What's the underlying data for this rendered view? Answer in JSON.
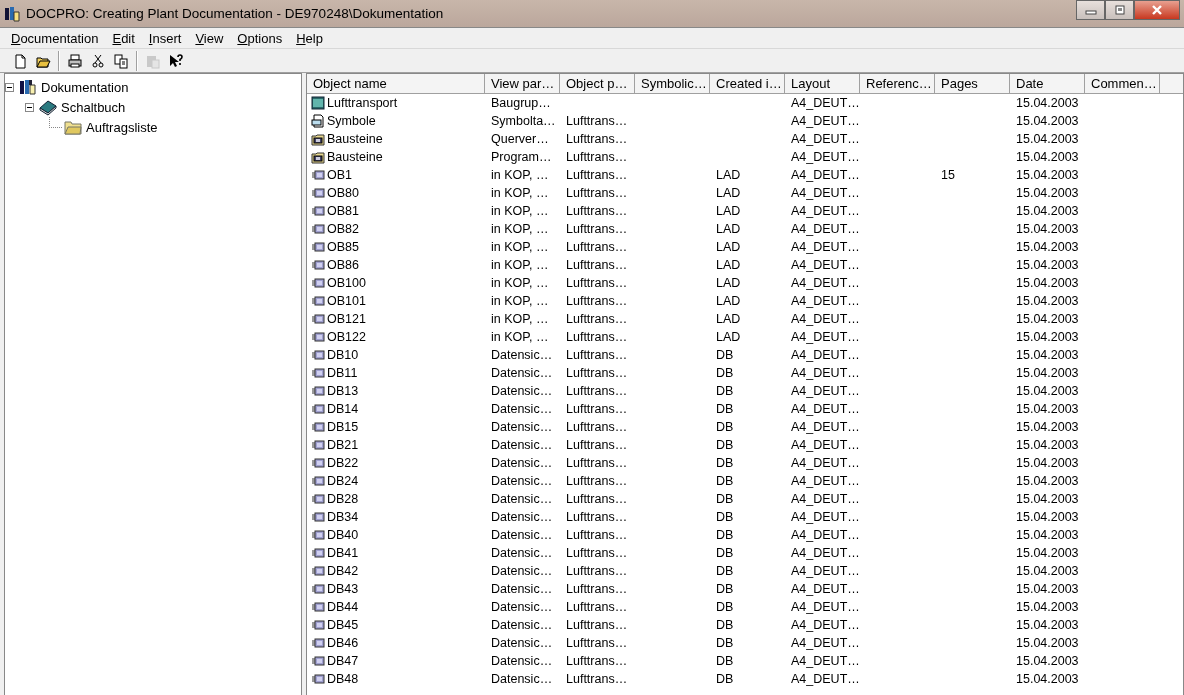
{
  "window": {
    "title": "DOCPRO: Creating Plant Documentation - DE970248\\Dokumentation"
  },
  "menu": [
    "Documentation",
    "Edit",
    "Insert",
    "View",
    "Options",
    "Help"
  ],
  "toolbar": [
    [
      {
        "kind": "new",
        "disabled": false
      },
      {
        "kind": "open",
        "disabled": false
      }
    ],
    [
      {
        "kind": "print",
        "disabled": false
      },
      {
        "kind": "cut",
        "disabled": false
      },
      {
        "kind": "copy",
        "disabled": false
      }
    ],
    [
      {
        "kind": "paste",
        "disabled": true
      },
      {
        "kind": "help",
        "disabled": false
      }
    ]
  ],
  "tree": [
    {
      "label": "Dokumentation",
      "kind": "docs",
      "expanded": true,
      "children": [
        {
          "label": "Schaltbuch",
          "kind": "book",
          "expanded": true,
          "children": [
            {
              "label": "Auftragsliste",
              "kind": "folder"
            }
          ]
        }
      ]
    }
  ],
  "table": {
    "columns": [
      "Object name",
      "View par…",
      "Object p…",
      "Symbolic…",
      "Created i…",
      "Layout",
      "Referenc…",
      "Pages",
      "Date",
      "Commen…"
    ],
    "rows": [
      {
        "kind": "module",
        "name": "Lufttransport",
        "view_part": "Baugrup…",
        "layout": "A4_DEUT…",
        "date": "15.04.2003"
      },
      {
        "kind": "symbol",
        "name": "Symbole",
        "view_part": "Symbolta…",
        "object_path": "Lufttrans…",
        "layout": "A4_DEUT…",
        "date": "15.04.2003"
      },
      {
        "kind": "blocks",
        "name": "Bausteine",
        "view_part": "Querver…",
        "object_path": "Lufttrans…",
        "layout": "A4_DEUT…",
        "date": "15.04.2003"
      },
      {
        "kind": "blocks",
        "name": "Bausteine",
        "view_part": "Program…",
        "object_path": "Lufttrans…",
        "layout": "A4_DEUT…",
        "date": "15.04.2003"
      },
      {
        "kind": "block",
        "name": "OB1",
        "view_part": "in KOP, …",
        "object_path": "Lufttrans…",
        "created_in": "LAD",
        "layout": "A4_DEUT…",
        "pages": "15",
        "date": "15.04.2003"
      },
      {
        "kind": "block",
        "name": "OB80",
        "view_part": "in KOP, …",
        "object_path": "Lufttrans…",
        "created_in": "LAD",
        "layout": "A4_DEUT…",
        "date": "15.04.2003"
      },
      {
        "kind": "block",
        "name": "OB81",
        "view_part": "in KOP, …",
        "object_path": "Lufttrans…",
        "created_in": "LAD",
        "layout": "A4_DEUT…",
        "date": "15.04.2003"
      },
      {
        "kind": "block",
        "name": "OB82",
        "view_part": "in KOP, …",
        "object_path": "Lufttrans…",
        "created_in": "LAD",
        "layout": "A4_DEUT…",
        "date": "15.04.2003"
      },
      {
        "kind": "block",
        "name": "OB85",
        "view_part": "in KOP, …",
        "object_path": "Lufttrans…",
        "created_in": "LAD",
        "layout": "A4_DEUT…",
        "date": "15.04.2003"
      },
      {
        "kind": "block",
        "name": "OB86",
        "view_part": "in KOP, …",
        "object_path": "Lufttrans…",
        "created_in": "LAD",
        "layout": "A4_DEUT…",
        "date": "15.04.2003"
      },
      {
        "kind": "block",
        "name": "OB100",
        "view_part": "in KOP, …",
        "object_path": "Lufttrans…",
        "created_in": "LAD",
        "layout": "A4_DEUT…",
        "date": "15.04.2003"
      },
      {
        "kind": "block",
        "name": "OB101",
        "view_part": "in KOP, …",
        "object_path": "Lufttrans…",
        "created_in": "LAD",
        "layout": "A4_DEUT…",
        "date": "15.04.2003"
      },
      {
        "kind": "block",
        "name": "OB121",
        "view_part": "in KOP, …",
        "object_path": "Lufttrans…",
        "created_in": "LAD",
        "layout": "A4_DEUT…",
        "date": "15.04.2003"
      },
      {
        "kind": "block",
        "name": "OB122",
        "view_part": "in KOP, …",
        "object_path": "Lufttrans…",
        "created_in": "LAD",
        "layout": "A4_DEUT…",
        "date": "15.04.2003"
      },
      {
        "kind": "block",
        "name": "DB10",
        "view_part": "Datensic…",
        "object_path": "Lufttrans…",
        "created_in": "DB",
        "layout": "A4_DEUT…",
        "date": "15.04.2003"
      },
      {
        "kind": "block",
        "name": "DB11",
        "view_part": "Datensic…",
        "object_path": "Lufttrans…",
        "created_in": "DB",
        "layout": "A4_DEUT…",
        "date": "15.04.2003"
      },
      {
        "kind": "block",
        "name": "DB13",
        "view_part": "Datensic…",
        "object_path": "Lufttrans…",
        "created_in": "DB",
        "layout": "A4_DEUT…",
        "date": "15.04.2003"
      },
      {
        "kind": "block",
        "name": "DB14",
        "view_part": "Datensic…",
        "object_path": "Lufttrans…",
        "created_in": "DB",
        "layout": "A4_DEUT…",
        "date": "15.04.2003"
      },
      {
        "kind": "block",
        "name": "DB15",
        "view_part": "Datensic…",
        "object_path": "Lufttrans…",
        "created_in": "DB",
        "layout": "A4_DEUT…",
        "date": "15.04.2003"
      },
      {
        "kind": "block",
        "name": "DB21",
        "view_part": "Datensic…",
        "object_path": "Lufttrans…",
        "created_in": "DB",
        "layout": "A4_DEUT…",
        "date": "15.04.2003"
      },
      {
        "kind": "block",
        "name": "DB22",
        "view_part": "Datensic…",
        "object_path": "Lufttrans…",
        "created_in": "DB",
        "layout": "A4_DEUT…",
        "date": "15.04.2003"
      },
      {
        "kind": "block",
        "name": "DB24",
        "view_part": "Datensic…",
        "object_path": "Lufttrans…",
        "created_in": "DB",
        "layout": "A4_DEUT…",
        "date": "15.04.2003"
      },
      {
        "kind": "block",
        "name": "DB28",
        "view_part": "Datensic…",
        "object_path": "Lufttrans…",
        "created_in": "DB",
        "layout": "A4_DEUT…",
        "date": "15.04.2003"
      },
      {
        "kind": "block",
        "name": "DB34",
        "view_part": "Datensic…",
        "object_path": "Lufttrans…",
        "created_in": "DB",
        "layout": "A4_DEUT…",
        "date": "15.04.2003"
      },
      {
        "kind": "block",
        "name": "DB40",
        "view_part": "Datensic…",
        "object_path": "Lufttrans…",
        "created_in": "DB",
        "layout": "A4_DEUT…",
        "date": "15.04.2003"
      },
      {
        "kind": "block",
        "name": "DB41",
        "view_part": "Datensic…",
        "object_path": "Lufttrans…",
        "created_in": "DB",
        "layout": "A4_DEUT…",
        "date": "15.04.2003"
      },
      {
        "kind": "block",
        "name": "DB42",
        "view_part": "Datensic…",
        "object_path": "Lufttrans…",
        "created_in": "DB",
        "layout": "A4_DEUT…",
        "date": "15.04.2003"
      },
      {
        "kind": "block",
        "name": "DB43",
        "view_part": "Datensic…",
        "object_path": "Lufttrans…",
        "created_in": "DB",
        "layout": "A4_DEUT…",
        "date": "15.04.2003"
      },
      {
        "kind": "block",
        "name": "DB44",
        "view_part": "Datensic…",
        "object_path": "Lufttrans…",
        "created_in": "DB",
        "layout": "A4_DEUT…",
        "date": "15.04.2003"
      },
      {
        "kind": "block",
        "name": "DB45",
        "view_part": "Datensic…",
        "object_path": "Lufttrans…",
        "created_in": "DB",
        "layout": "A4_DEUT…",
        "date": "15.04.2003"
      },
      {
        "kind": "block",
        "name": "DB46",
        "view_part": "Datensic…",
        "object_path": "Lufttrans…",
        "created_in": "DB",
        "layout": "A4_DEUT…",
        "date": "15.04.2003"
      },
      {
        "kind": "block",
        "name": "DB47",
        "view_part": "Datensic…",
        "object_path": "Lufttrans…",
        "created_in": "DB",
        "layout": "A4_DEUT…",
        "date": "15.04.2003"
      },
      {
        "kind": "block",
        "name": "DB48",
        "view_part": "Datensic…",
        "object_path": "Lufttrans…",
        "created_in": "DB",
        "layout": "A4_DEUT…",
        "date": "15.04.2003"
      }
    ]
  }
}
